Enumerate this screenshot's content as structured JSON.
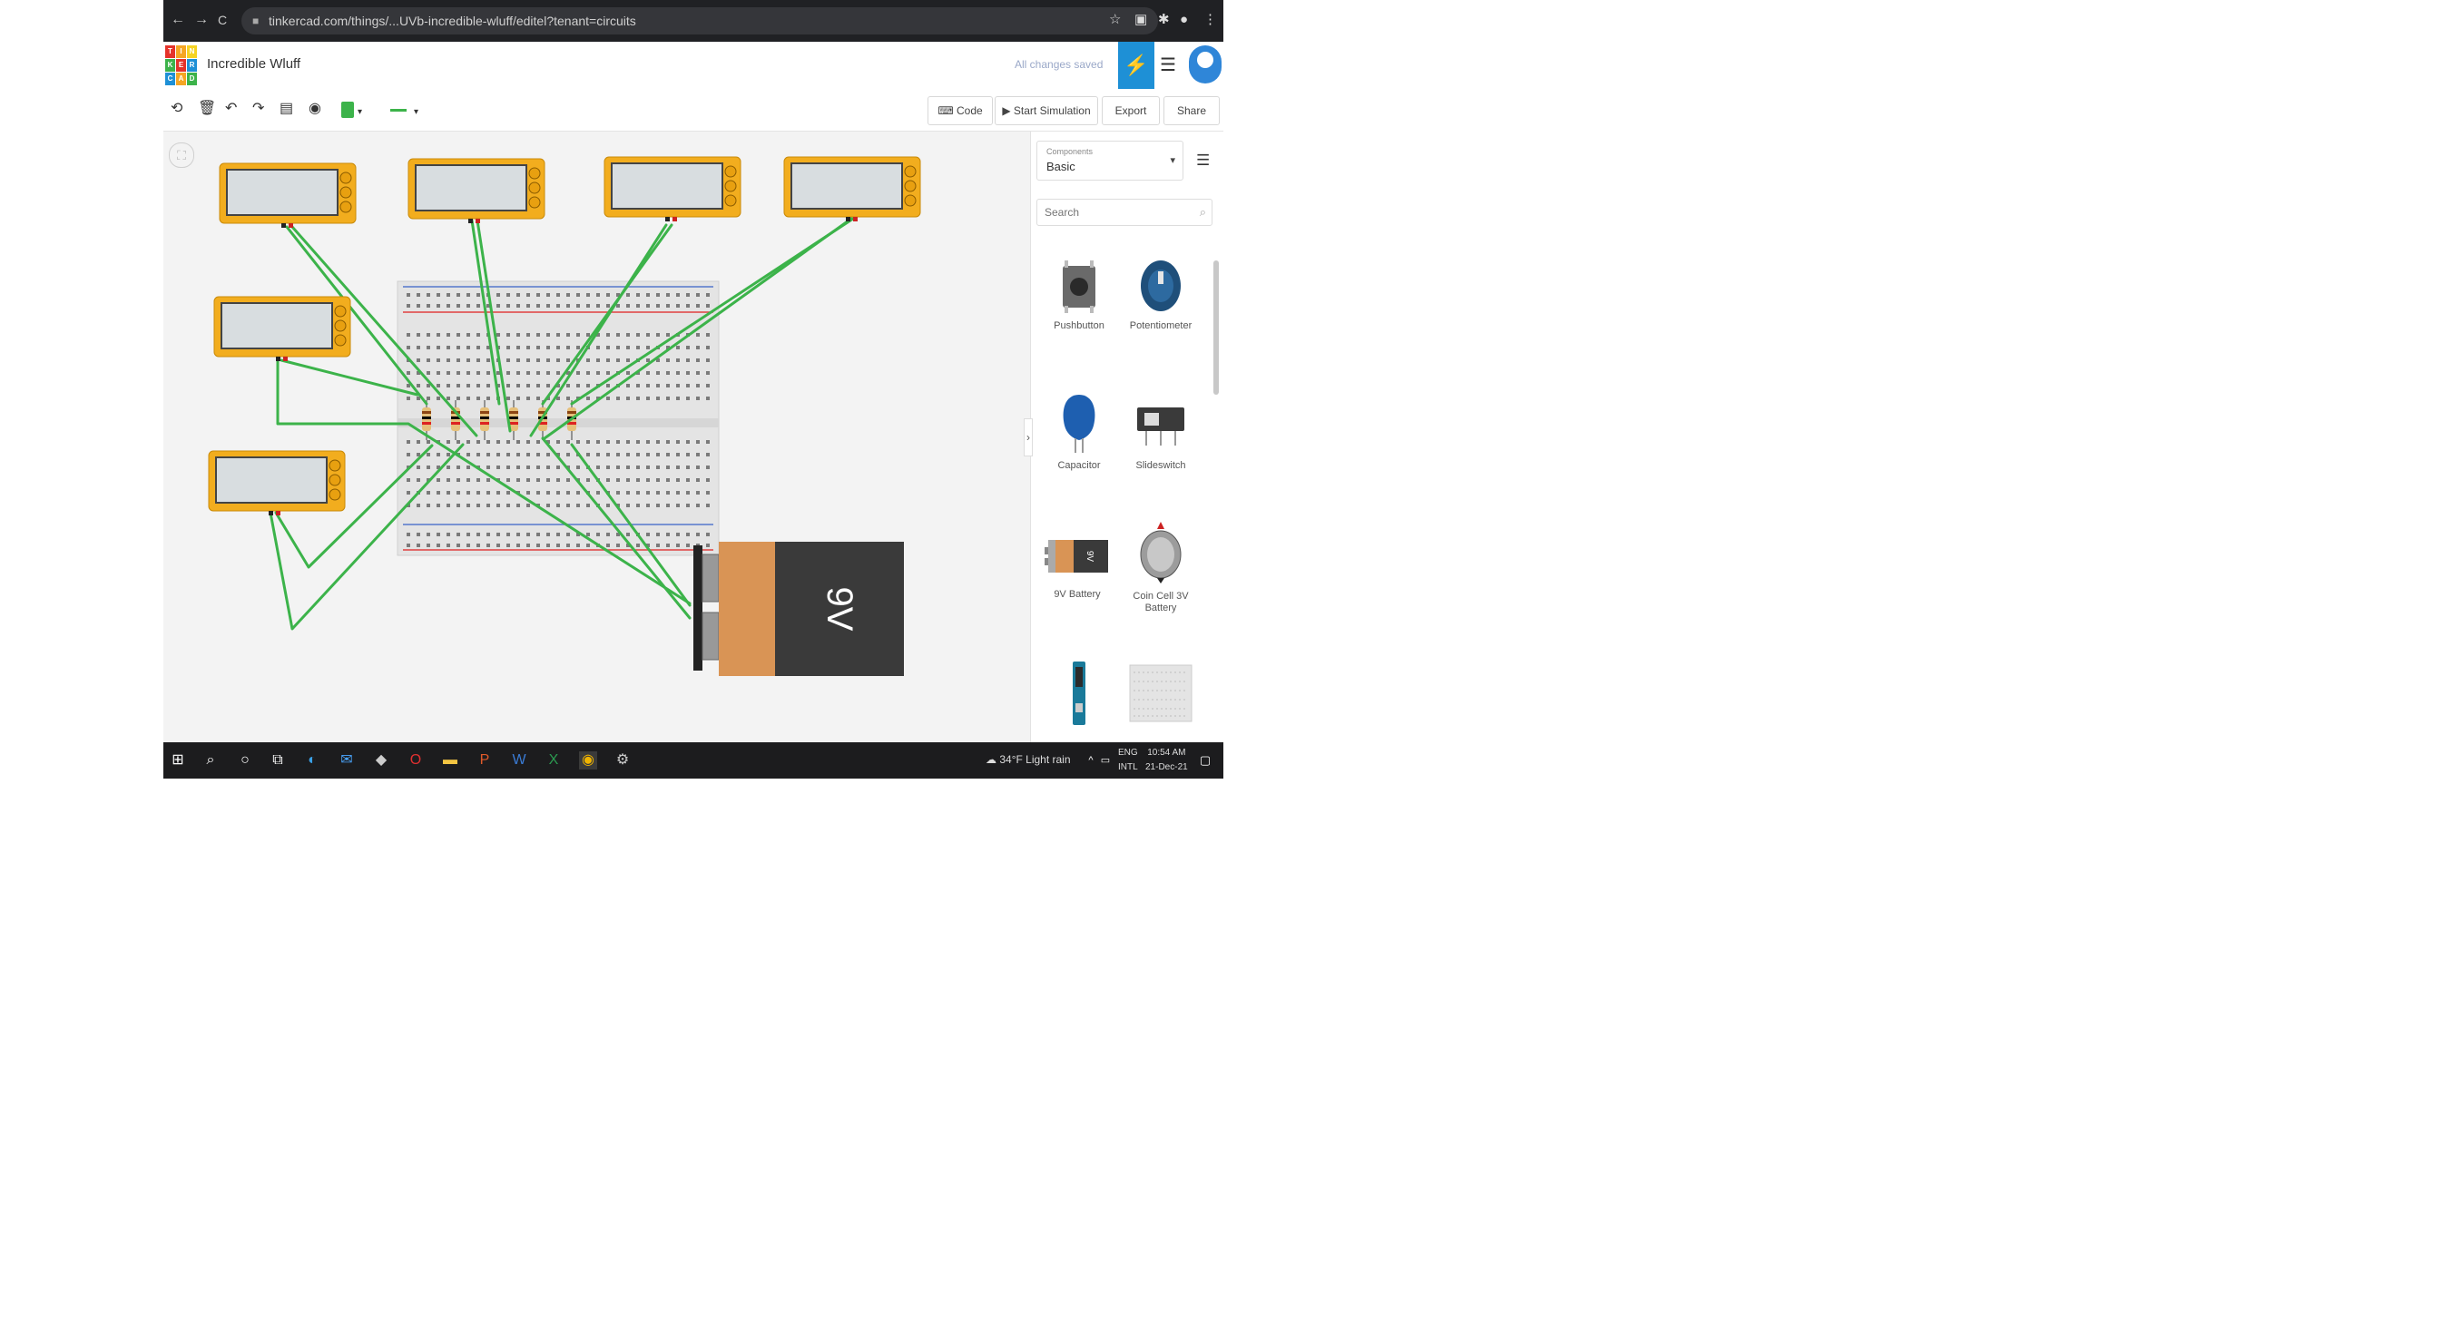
{
  "browser": {
    "url": "tinkercad.com/things/...UVb-incredible-wluff/editel?tenant=circuits",
    "nav_back": "←",
    "nav_forward": "→",
    "nav_reload": "C"
  },
  "header": {
    "logo_letters": [
      "T",
      "I",
      "N",
      "K",
      "E",
      "R",
      "C",
      "A",
      "D"
    ],
    "title": "Incredible Wluff",
    "save_status": "All changes saved"
  },
  "toolbar": {
    "code_label": "Code",
    "start_sim_label": "Start Simulation",
    "export_label": "Export",
    "share_label": "Share",
    "wire_color": "#3cb34a"
  },
  "canvas": {
    "battery_label": "9V"
  },
  "panel": {
    "components_label": "Components",
    "components_value": "Basic",
    "search_placeholder": "Search",
    "items": [
      {
        "label": "Pushbutton"
      },
      {
        "label": "Potentiometer"
      },
      {
        "label": "Capacitor"
      },
      {
        "label": "Slideswitch"
      },
      {
        "label": "9V Battery"
      },
      {
        "label": "Coin Cell 3V Battery"
      }
    ]
  },
  "taskbar": {
    "weather": "34°F Light rain",
    "lang_line1": "ENG",
    "lang_line2": "INTL",
    "time": "10:54 AM",
    "date": "21-Dec-21"
  },
  "colors": {
    "accent": "#1e90d6",
    "multimeter": "#f2ad1e",
    "wire": "#3cb34a",
    "battery_body": "#3a3a3a",
    "battery_label": "#d99455"
  }
}
